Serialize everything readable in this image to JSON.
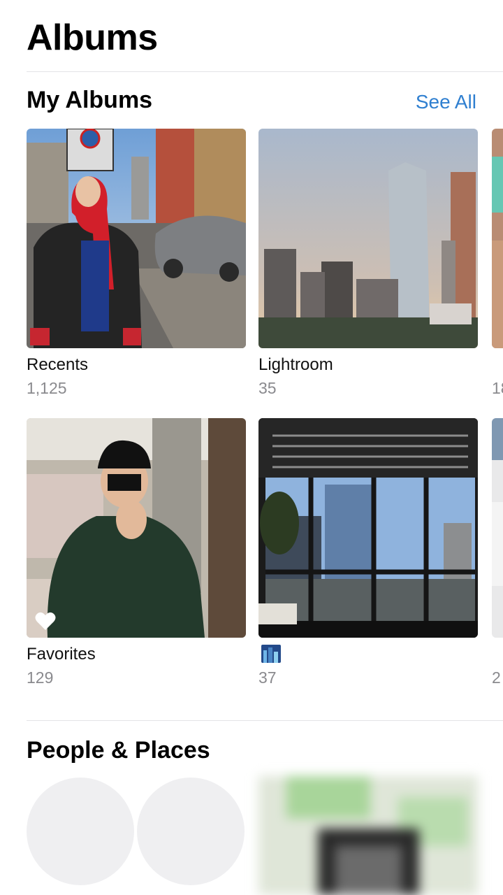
{
  "header": {
    "title": "Albums"
  },
  "my_albums": {
    "title": "My Albums",
    "see_all_label": "See All",
    "albums": [
      {
        "name": "Recents",
        "count": "1,125"
      },
      {
        "name": "Lightroom",
        "count": "35"
      },
      {
        "name": "",
        "count": "18"
      },
      {
        "name": "Favorites",
        "count": "129"
      },
      {
        "name": "",
        "count": "37"
      },
      {
        "name": "",
        "count": "2"
      }
    ]
  },
  "people_places": {
    "title": "People & Places"
  },
  "colors": {
    "accent": "#2f7fd0",
    "secondary_text": "#8a8a8e",
    "divider": "#e3e3e6",
    "placeholder": "#efeff1"
  }
}
